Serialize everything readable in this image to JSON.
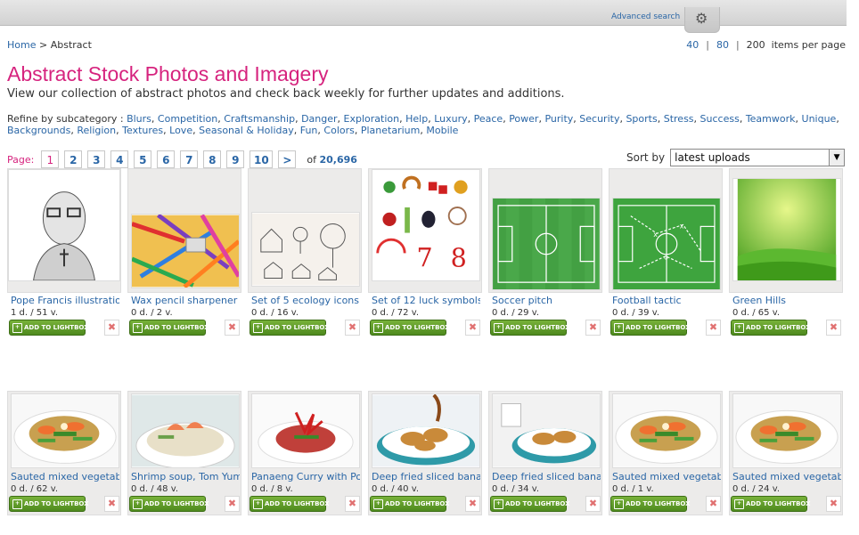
{
  "header": {
    "advanced_search": "Advanced search",
    "gear_icon": "gear-icon"
  },
  "breadcrumb": {
    "home": "Home",
    "sep": ">",
    "current": "Abstract"
  },
  "per_page": {
    "opt1": "40",
    "opt2": "80",
    "opt3": "200",
    "sep": "|",
    "suffix": "items per page"
  },
  "page": {
    "title": "Abstract Stock Photos and Imagery",
    "intro": "View our collection of abstract photos and check back weekly for further updates and additions."
  },
  "refine": {
    "label": "Refine by subcategory :",
    "items": [
      "Blurs",
      "Competition",
      "Craftsmanship",
      "Danger",
      "Exploration",
      "Help",
      "Luxury",
      "Peace",
      "Power",
      "Purity",
      "Security",
      "Sports",
      "Stress",
      "Success",
      "Teamwork",
      "Unique",
      "Backgrounds",
      "Religion",
      "Textures",
      "Love",
      "Seasonal & Holiday",
      "Fun",
      "Colors",
      "Planetarium",
      "Mobile"
    ]
  },
  "pager": {
    "label": "Page:",
    "pages": [
      "1",
      "2",
      "3",
      "4",
      "5",
      "6",
      "7",
      "8",
      "9",
      "10"
    ],
    "next": ">",
    "of_label": "of",
    "total": "20,696"
  },
  "sort": {
    "label": "Sort by",
    "selected": "latest uploads"
  },
  "lightbox_label": "ADD TO LIGHTBOX",
  "remove_symbol": "✖",
  "row1": [
    {
      "title": "Pope Francis illustration",
      "stats": "1 d. / 51 v."
    },
    {
      "title": "Wax pencil sharpener",
      "stats": "0 d. / 2 v."
    },
    {
      "title": "Set of 5 ecology icons",
      "stats": "0 d. / 16 v."
    },
    {
      "title": "Set of 12 luck symbols",
      "stats": "0 d. / 72 v."
    },
    {
      "title": "Soccer pitch",
      "stats": "0 d. / 29 v."
    },
    {
      "title": "Football tactic",
      "stats": "0 d. / 39 v."
    },
    {
      "title": "Green Hills",
      "stats": "0 d. / 65 v."
    }
  ],
  "row2": [
    {
      "title": "Sauted mixed vegetables",
      "stats": "0 d. / 62 v."
    },
    {
      "title": "Shrimp soup, Tom Yum",
      "stats": "0 d. / 48 v."
    },
    {
      "title": "Panaeng Curry with Pork",
      "stats": "0 d. / 8 v."
    },
    {
      "title": "Deep fried sliced banana",
      "stats": "0 d. / 40 v."
    },
    {
      "title": "Deep fried sliced banana",
      "stats": "0 d. / 34 v."
    },
    {
      "title": "Sauted mixed vegetables",
      "stats": "0 d. / 1 v."
    },
    {
      "title": "Sauted mixed vegetables",
      "stats": "0 d. / 24 v."
    }
  ]
}
